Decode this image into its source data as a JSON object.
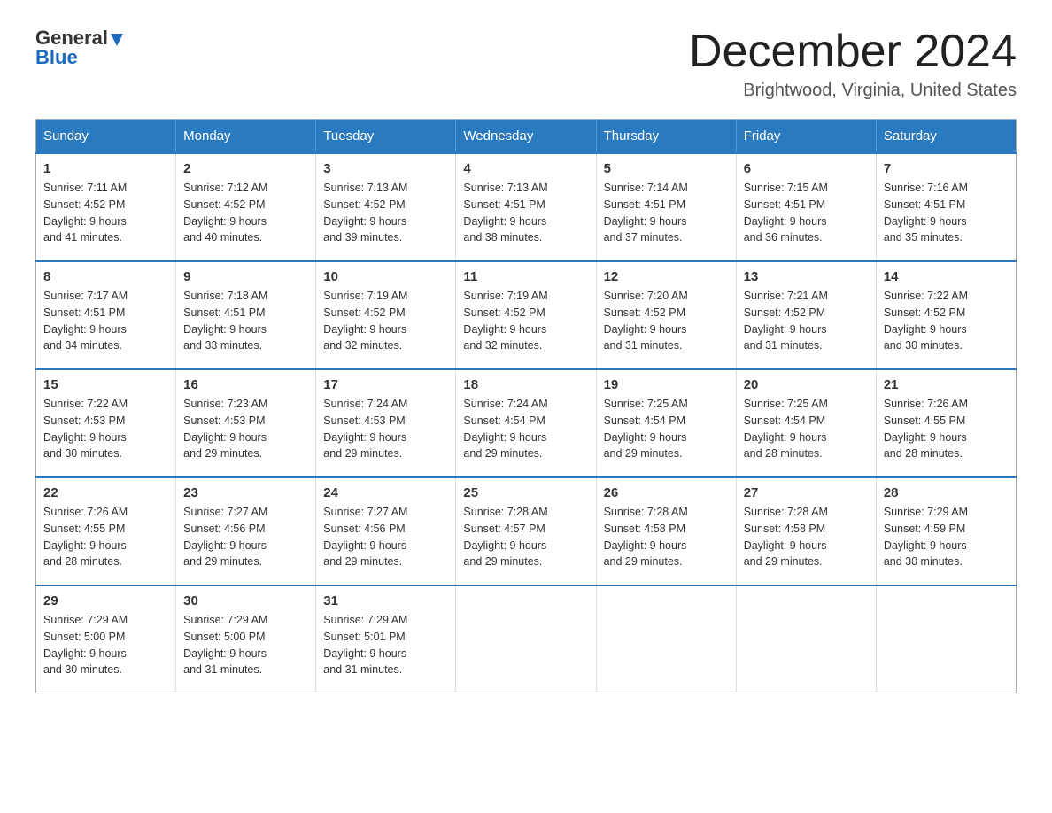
{
  "header": {
    "logo": {
      "general": "General",
      "blue": "Blue"
    },
    "title": "December 2024",
    "location": "Brightwood, Virginia, United States"
  },
  "weekdays": [
    "Sunday",
    "Monday",
    "Tuesday",
    "Wednesday",
    "Thursday",
    "Friday",
    "Saturday"
  ],
  "weeks": [
    [
      {
        "day": "1",
        "sunrise": "7:11 AM",
        "sunset": "4:52 PM",
        "daylight": "9 hours and 41 minutes."
      },
      {
        "day": "2",
        "sunrise": "7:12 AM",
        "sunset": "4:52 PM",
        "daylight": "9 hours and 40 minutes."
      },
      {
        "day": "3",
        "sunrise": "7:13 AM",
        "sunset": "4:52 PM",
        "daylight": "9 hours and 39 minutes."
      },
      {
        "day": "4",
        "sunrise": "7:13 AM",
        "sunset": "4:51 PM",
        "daylight": "9 hours and 38 minutes."
      },
      {
        "day": "5",
        "sunrise": "7:14 AM",
        "sunset": "4:51 PM",
        "daylight": "9 hours and 37 minutes."
      },
      {
        "day": "6",
        "sunrise": "7:15 AM",
        "sunset": "4:51 PM",
        "daylight": "9 hours and 36 minutes."
      },
      {
        "day": "7",
        "sunrise": "7:16 AM",
        "sunset": "4:51 PM",
        "daylight": "9 hours and 35 minutes."
      }
    ],
    [
      {
        "day": "8",
        "sunrise": "7:17 AM",
        "sunset": "4:51 PM",
        "daylight": "9 hours and 34 minutes."
      },
      {
        "day": "9",
        "sunrise": "7:18 AM",
        "sunset": "4:51 PM",
        "daylight": "9 hours and 33 minutes."
      },
      {
        "day": "10",
        "sunrise": "7:19 AM",
        "sunset": "4:52 PM",
        "daylight": "9 hours and 32 minutes."
      },
      {
        "day": "11",
        "sunrise": "7:19 AM",
        "sunset": "4:52 PM",
        "daylight": "9 hours and 32 minutes."
      },
      {
        "day": "12",
        "sunrise": "7:20 AM",
        "sunset": "4:52 PM",
        "daylight": "9 hours and 31 minutes."
      },
      {
        "day": "13",
        "sunrise": "7:21 AM",
        "sunset": "4:52 PM",
        "daylight": "9 hours and 31 minutes."
      },
      {
        "day": "14",
        "sunrise": "7:22 AM",
        "sunset": "4:52 PM",
        "daylight": "9 hours and 30 minutes."
      }
    ],
    [
      {
        "day": "15",
        "sunrise": "7:22 AM",
        "sunset": "4:53 PM",
        "daylight": "9 hours and 30 minutes."
      },
      {
        "day": "16",
        "sunrise": "7:23 AM",
        "sunset": "4:53 PM",
        "daylight": "9 hours and 29 minutes."
      },
      {
        "day": "17",
        "sunrise": "7:24 AM",
        "sunset": "4:53 PM",
        "daylight": "9 hours and 29 minutes."
      },
      {
        "day": "18",
        "sunrise": "7:24 AM",
        "sunset": "4:54 PM",
        "daylight": "9 hours and 29 minutes."
      },
      {
        "day": "19",
        "sunrise": "7:25 AM",
        "sunset": "4:54 PM",
        "daylight": "9 hours and 29 minutes."
      },
      {
        "day": "20",
        "sunrise": "7:25 AM",
        "sunset": "4:54 PM",
        "daylight": "9 hours and 28 minutes."
      },
      {
        "day": "21",
        "sunrise": "7:26 AM",
        "sunset": "4:55 PM",
        "daylight": "9 hours and 28 minutes."
      }
    ],
    [
      {
        "day": "22",
        "sunrise": "7:26 AM",
        "sunset": "4:55 PM",
        "daylight": "9 hours and 28 minutes."
      },
      {
        "day": "23",
        "sunrise": "7:27 AM",
        "sunset": "4:56 PM",
        "daylight": "9 hours and 29 minutes."
      },
      {
        "day": "24",
        "sunrise": "7:27 AM",
        "sunset": "4:56 PM",
        "daylight": "9 hours and 29 minutes."
      },
      {
        "day": "25",
        "sunrise": "7:28 AM",
        "sunset": "4:57 PM",
        "daylight": "9 hours and 29 minutes."
      },
      {
        "day": "26",
        "sunrise": "7:28 AM",
        "sunset": "4:58 PM",
        "daylight": "9 hours and 29 minutes."
      },
      {
        "day": "27",
        "sunrise": "7:28 AM",
        "sunset": "4:58 PM",
        "daylight": "9 hours and 29 minutes."
      },
      {
        "day": "28",
        "sunrise": "7:29 AM",
        "sunset": "4:59 PM",
        "daylight": "9 hours and 30 minutes."
      }
    ],
    [
      {
        "day": "29",
        "sunrise": "7:29 AM",
        "sunset": "5:00 PM",
        "daylight": "9 hours and 30 minutes."
      },
      {
        "day": "30",
        "sunrise": "7:29 AM",
        "sunset": "5:00 PM",
        "daylight": "9 hours and 31 minutes."
      },
      {
        "day": "31",
        "sunrise": "7:29 AM",
        "sunset": "5:01 PM",
        "daylight": "9 hours and 31 minutes."
      },
      null,
      null,
      null,
      null
    ]
  ],
  "labels": {
    "sunrise": "Sunrise:",
    "sunset": "Sunset:",
    "daylight": "Daylight:"
  }
}
